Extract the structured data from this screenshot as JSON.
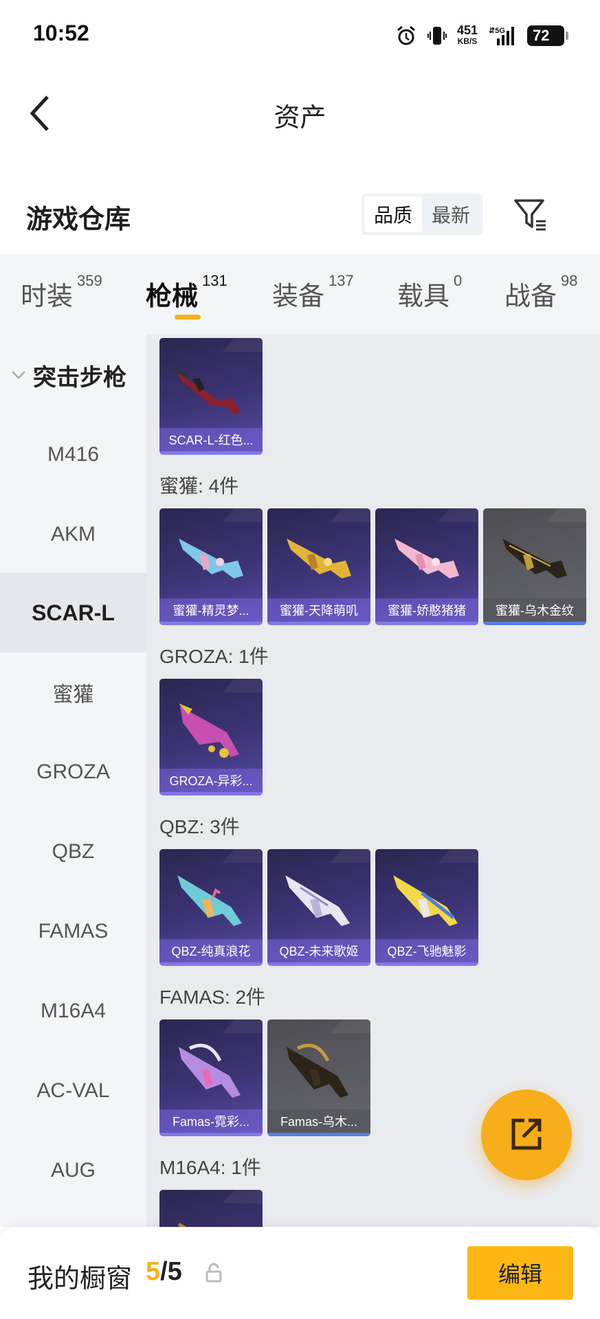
{
  "status_bar": {
    "time": "10:52",
    "net_speed": "451",
    "net_unit": "KB/S",
    "network": "5G",
    "battery": "72"
  },
  "header": {
    "title": "资产"
  },
  "warehouse": {
    "title": "游戏仓库",
    "sort_options": [
      "品质",
      "最新"
    ],
    "active_sort": "品质"
  },
  "tabs": [
    {
      "label": "时装",
      "count": "359"
    },
    {
      "label": "枪械",
      "count": "131",
      "active": true
    },
    {
      "label": "装备",
      "count": "137"
    },
    {
      "label": "载具",
      "count": "0"
    },
    {
      "label": "战备",
      "count": "98"
    }
  ],
  "sidebar": {
    "header": "突击步枪",
    "items": [
      "M416",
      "AKM",
      "SCAR-L",
      "蜜獾",
      "GROZA",
      "QBZ",
      "FAMAS",
      "M16A4",
      "AC-VAL",
      "AUG"
    ],
    "active": "SCAR-L"
  },
  "groups": [
    {
      "label": "",
      "items": [
        {
          "name": "SCAR-L-红色..."
        }
      ]
    },
    {
      "label": "蜜獾: 4件",
      "items": [
        {
          "name": "蜜獾-精灵梦..."
        },
        {
          "name": "蜜獾-天降萌叽"
        },
        {
          "name": "蜜獾-娇憨猪猪"
        },
        {
          "name": "蜜獾-乌木金纹"
        }
      ]
    },
    {
      "label": "GROZA: 1件",
      "items": [
        {
          "name": "GROZA-异彩..."
        }
      ]
    },
    {
      "label": "QBZ: 3件",
      "items": [
        {
          "name": "QBZ-纯真浪花"
        },
        {
          "name": "QBZ-未来歌姬"
        },
        {
          "name": "QBZ-飞驰魅影"
        }
      ]
    },
    {
      "label": "FAMAS: 2件",
      "items": [
        {
          "name": "Famas-霓彩..."
        },
        {
          "name": "Famas-乌木..."
        }
      ]
    },
    {
      "label": "M16A4: 1件",
      "items": [
        {
          "name": ""
        }
      ]
    }
  ],
  "showcase": {
    "label": "我的橱窗",
    "current": "5",
    "separator": "/",
    "total": "5"
  },
  "edit_label": "编辑",
  "colors": {
    "accent": "#f5b21b",
    "card_purple": "#3d3476",
    "card_grey": "#5c5c63"
  }
}
